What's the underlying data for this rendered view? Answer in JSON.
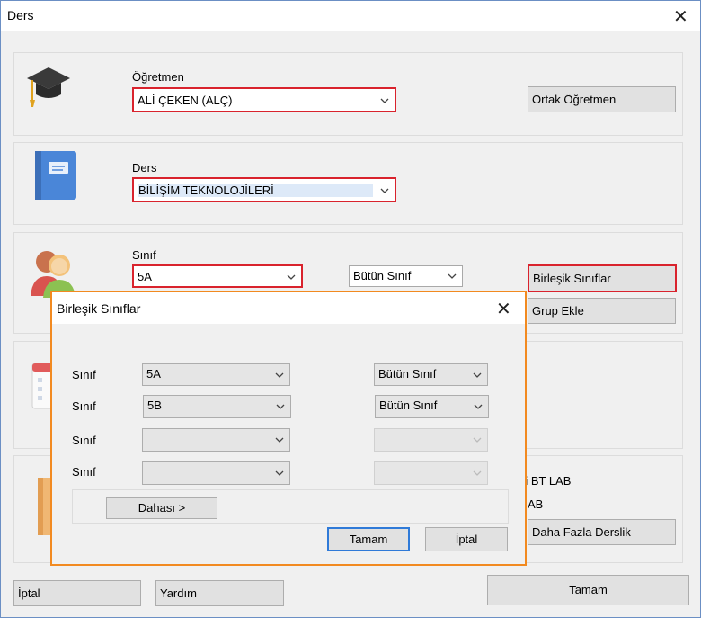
{
  "window": {
    "title": "Ders",
    "close_glyph": "✕"
  },
  "teacher": {
    "label": "Öğretmen",
    "value": "ALİ ÇEKEN (ALÇ)",
    "shared_button": "Ortak Öğretmen"
  },
  "lesson": {
    "label": "Ders",
    "value": "BİLİŞİM TEKNOLOJİLERİ"
  },
  "class": {
    "label": "Sınıf",
    "value": "5A",
    "scope": "Bütün Sınıf",
    "combined_button": "Birleşik Sınıflar",
    "group_button": "Grup Ekle"
  },
  "room": {
    "item1": "ri BT LAB",
    "item2": "AB",
    "more_rooms_button": "Daha Fazla Derslik"
  },
  "footer": {
    "cancel": "İptal",
    "help": "Yardım",
    "ok": "Tamam"
  },
  "dialog": {
    "title": "Birleşik Sınıflar",
    "close_glyph": "✕",
    "rows": [
      {
        "label": "Sınıf",
        "class": "5A",
        "scope": "Bütün Sınıf"
      },
      {
        "label": "Sınıf",
        "class": "5B",
        "scope": "Bütün Sınıf"
      },
      {
        "label": "Sınıf",
        "class": "",
        "scope": ""
      },
      {
        "label": "Sınıf",
        "class": "",
        "scope": ""
      }
    ],
    "more_button": "Dahası >",
    "ok_button": "Tamam",
    "cancel_button": "İptal"
  },
  "icons": [
    "graduation-cap-icon",
    "book-icon",
    "people-icon",
    "calendar-icon",
    "door-icon"
  ],
  "colors": {
    "highlight": "#d9232d",
    "dialog_border": "#f28a20",
    "focus": "#2f7ad8"
  }
}
